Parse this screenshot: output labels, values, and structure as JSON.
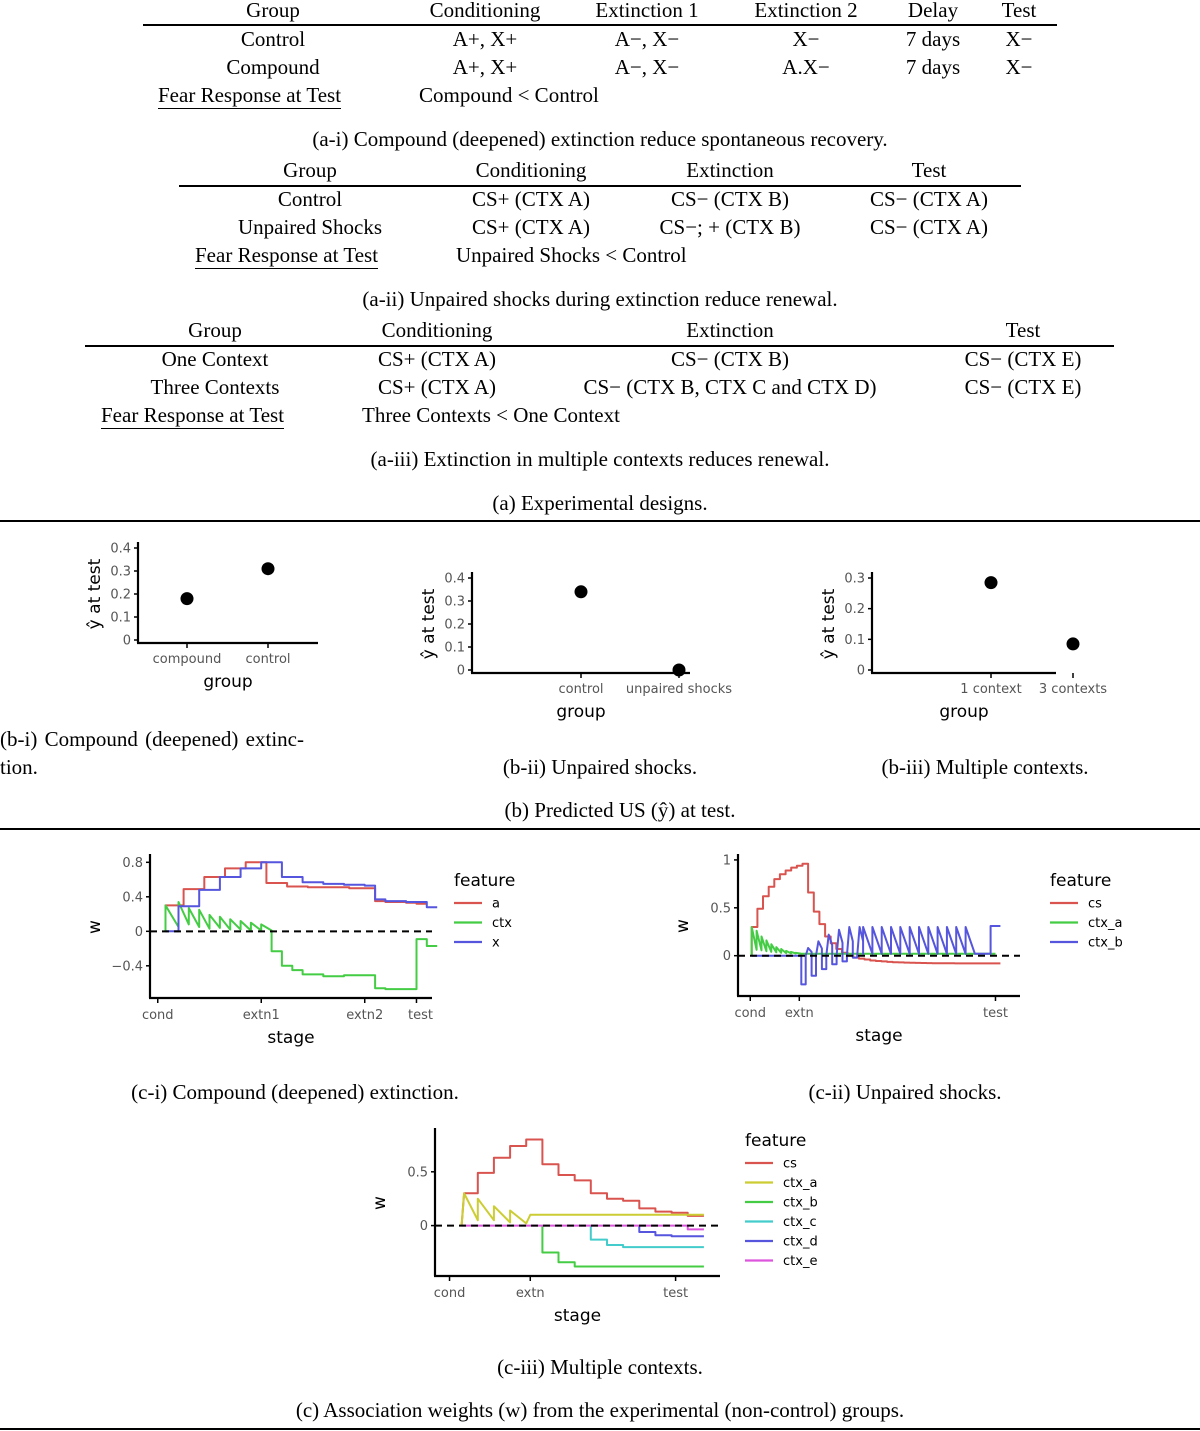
{
  "section_a": {
    "table1": {
      "headers": [
        "Group",
        "Conditioning",
        "Extinction 1",
        "Extinction 2",
        "Delay",
        "Test"
      ],
      "rows": [
        [
          "Control",
          "A+, X+",
          "A−, X−",
          "X−",
          "7 days",
          "X−"
        ],
        [
          "Compound",
          "A+, X+",
          "A−, X−",
          "A.X−",
          "7 days",
          "X−"
        ]
      ],
      "result_label": "Fear Response at Test",
      "result_value": "Compound < Control",
      "caption": "(a-i) Compound (deepened) extinction reduce spontaneous recovery."
    },
    "table2": {
      "headers": [
        "Group",
        "Conditioning",
        "Extinction",
        "Test"
      ],
      "rows": [
        [
          "Control",
          "CS+ (CTX A)",
          "CS− (CTX B)",
          "CS− (CTX A)"
        ],
        [
          "Unpaired Shocks",
          "CS+ (CTX A)",
          "CS−; + (CTX B)",
          "CS− (CTX A)"
        ]
      ],
      "result_label": "Fear Response at Test",
      "result_value": "Unpaired Shocks < Control",
      "caption": "(a-ii) Unpaired shocks during extinction reduce renewal."
    },
    "table3": {
      "headers": [
        "Group",
        "Conditioning",
        "Extinction",
        "Test"
      ],
      "rows": [
        [
          "One Context",
          "CS+ (CTX A)",
          "CS− (CTX B)",
          "CS− (CTX E)"
        ],
        [
          "Three Contexts",
          "CS+ (CTX A)",
          "CS− (CTX B, CTX C and CTX D)",
          "CS− (CTX E)"
        ]
      ],
      "result_label": "Fear Response at Test",
      "result_value": "Three Contexts < One Context",
      "caption": "(a-iii) Extinction in multiple contexts reduces renewal."
    },
    "caption": "(a) Experimental designs."
  },
  "section_b": {
    "caption_bi_line1": "(b-i)   Compound   (deepened)   extinc-",
    "caption_bi_line2": "tion.",
    "caption_bii": "(b-ii) Unpaired shocks.",
    "caption_biii": "(b-iii) Multiple contexts.",
    "caption": "(b) Predicted US (ŷ) at test."
  },
  "section_c": {
    "caption_ci": "(c-i) Compound (deepened) extinction.",
    "caption_cii": "(c-ii) Unpaired shocks.",
    "caption_ciii": "(c-iii) Multiple contexts.",
    "caption": "(c) Association weights (w) from the experimental (non-control) groups."
  },
  "chart_data": [
    {
      "id": "b-i",
      "type": "scatter",
      "xlabel": "group",
      "ylabel": "ŷ at test",
      "categories": [
        "compound",
        "control"
      ],
      "values": [
        0.18,
        0.31
      ],
      "ylim": [
        0,
        0.4
      ],
      "yticks": [
        0,
        0.1,
        0.2,
        0.3,
        0.4
      ],
      "ytick_labels": [
        "0",
        "0.1",
        "0.2",
        "0.3",
        "0.4"
      ]
    },
    {
      "id": "b-ii",
      "type": "scatter",
      "xlabel": "group",
      "ylabel": "ŷ at test",
      "categories": [
        "control",
        "unpaired shocks"
      ],
      "values": [
        0.34,
        0.0
      ],
      "ylim": [
        0,
        0.4
      ],
      "yticks": [
        0,
        0.1,
        0.2,
        0.3,
        0.4
      ],
      "ytick_labels": [
        "0",
        "0.1",
        "0.2",
        "0.3",
        "0.4"
      ]
    },
    {
      "id": "b-iii",
      "type": "scatter",
      "xlabel": "group",
      "ylabel": "ŷ at test",
      "categories": [
        "1 context",
        "3 contexts"
      ],
      "values": [
        0.285,
        0.085
      ],
      "ylim": [
        0,
        0.3
      ],
      "yticks": [
        0,
        0.1,
        0.2,
        0.3
      ],
      "ytick_labels": [
        "0",
        "0.1",
        "0.2",
        "0.3"
      ]
    },
    {
      "id": "c-i",
      "type": "line",
      "xlabel": "stage",
      "ylabel": "w",
      "legend_title": "feature",
      "legend_position": "right",
      "xticks": [
        {
          "x": 0,
          "label": "cond"
        },
        {
          "x": 20,
          "label": "extn1"
        },
        {
          "x": 40,
          "label": "extn2"
        },
        {
          "x": 50,
          "label": "test"
        }
      ],
      "xlim": [
        -1.5,
        53
      ],
      "ylim": [
        -0.75,
        0.85
      ],
      "yticks": [
        -0.4,
        0,
        0.4,
        0.8
      ],
      "ytick_labels": [
        "−0.4",
        "0",
        "0.4",
        "0.8"
      ],
      "series": [
        {
          "name": "a",
          "color": "#d9534f",
          "kind": "step",
          "points": [
            [
              1.5,
              0
            ],
            [
              1.5,
              0.3
            ],
            [
              5,
              0.3
            ],
            [
              5,
              0.49
            ],
            [
              9,
              0.49
            ],
            [
              9,
              0.63
            ],
            [
              13,
              0.63
            ],
            [
              13,
              0.73
            ],
            [
              17,
              0.73
            ],
            [
              17,
              0.8
            ],
            [
              21,
              0.8
            ],
            [
              21,
              0.56
            ],
            [
              25,
              0.56
            ],
            [
              25,
              0.52
            ],
            [
              29,
              0.52
            ],
            [
              29,
              0.51
            ],
            [
              37,
              0.51
            ],
            [
              37,
              0.5
            ],
            [
              42,
              0.5
            ],
            [
              42,
              0.35
            ],
            [
              44,
              0.35
            ],
            [
              44,
              0.34
            ],
            [
              48,
              0.34
            ],
            [
              48,
              0.33
            ],
            [
              50,
              0.33
            ],
            [
              50,
              0.32
            ],
            [
              52,
              0.32
            ]
          ]
        },
        {
          "name": "ctx",
          "color": "#44cc44",
          "kind": "line",
          "points": [
            [
              1.5,
              0
            ],
            [
              1.5,
              0.3
            ],
            [
              4,
              0.05
            ],
            [
              4,
              0.34
            ],
            [
              6,
              0.08
            ],
            [
              6,
              0.27
            ],
            [
              8,
              0.05
            ],
            [
              8,
              0.25
            ],
            [
              10,
              0.03
            ],
            [
              10,
              0.19
            ],
            [
              12,
              0.04
            ],
            [
              12,
              0.17
            ],
            [
              14,
              0.02
            ],
            [
              14,
              0.14
            ],
            [
              16,
              0.02
            ],
            [
              16,
              0.12
            ],
            [
              18,
              0.01
            ],
            [
              18,
              0.1
            ],
            [
              20,
              0.01
            ],
            [
              20,
              0.08
            ],
            [
              22,
              0.01
            ],
            [
              22,
              -0.23
            ],
            [
              24,
              -0.23
            ],
            [
              24,
              -0.4
            ],
            [
              26,
              -0.4
            ],
            [
              26,
              -0.45
            ],
            [
              28,
              -0.45
            ],
            [
              28,
              -0.5
            ],
            [
              32,
              -0.5
            ],
            [
              32,
              -0.52
            ],
            [
              36,
              -0.52
            ],
            [
              36,
              -0.51
            ],
            [
              42,
              -0.51
            ],
            [
              42,
              -0.66
            ],
            [
              44,
              -0.66
            ],
            [
              44,
              -0.67
            ],
            [
              50,
              -0.67
            ],
            [
              50,
              -0.09
            ],
            [
              52,
              -0.09
            ],
            [
              52,
              -0.17
            ],
            [
              54,
              -0.17
            ]
          ]
        },
        {
          "name": "x",
          "color": "#5555dd",
          "kind": "step",
          "points": [
            [
              1.5,
              0
            ],
            [
              4,
              0
            ],
            [
              4,
              0.29
            ],
            [
              8,
              0.29
            ],
            [
              8,
              0.48
            ],
            [
              12,
              0.48
            ],
            [
              12,
              0.63
            ],
            [
              16,
              0.63
            ],
            [
              16,
              0.73
            ],
            [
              20,
              0.73
            ],
            [
              20,
              0.8
            ],
            [
              24,
              0.8
            ],
            [
              24,
              0.63
            ],
            [
              28,
              0.63
            ],
            [
              28,
              0.57
            ],
            [
              32,
              0.57
            ],
            [
              32,
              0.55
            ],
            [
              36,
              0.55
            ],
            [
              36,
              0.54
            ],
            [
              40,
              0.54
            ],
            [
              40,
              0.53
            ],
            [
              42,
              0.53
            ],
            [
              42,
              0.37
            ],
            [
              44,
              0.37
            ],
            [
              44,
              0.35
            ],
            [
              48,
              0.35
            ],
            [
              48,
              0.34
            ],
            [
              52,
              0.34
            ],
            [
              52,
              0.28
            ],
            [
              54,
              0.28
            ]
          ]
        }
      ]
    },
    {
      "id": "c-ii",
      "type": "line",
      "xlabel": "stage",
      "ylabel": "w",
      "legend_title": "feature",
      "legend_position": "right",
      "xticks": [
        {
          "x": 0,
          "label": "cond"
        },
        {
          "x": 10,
          "label": "extn"
        },
        {
          "x": 50,
          "label": "test"
        }
      ],
      "xlim": [
        -2.5,
        55
      ],
      "ylim": [
        -0.4,
        1.02
      ],
      "yticks": [
        0,
        0.5,
        1
      ],
      "ytick_labels": [
        "0",
        "0.5",
        "1"
      ],
      "series": [
        {
          "name": "cs",
          "color": "#d9534f",
          "kind": "step",
          "values": [
            0.3,
            0.49,
            0.62,
            0.72,
            0.8,
            0.85,
            0.89,
            0.92,
            0.94,
            0.96,
            0.66,
            0.46,
            0.33,
            0.2,
            0.13,
            0.07,
            0.03,
            0.0,
            -0.02,
            -0.03,
            -0.04,
            -0.05,
            -0.055,
            -0.06,
            -0.065,
            -0.068,
            -0.07,
            -0.072,
            -0.074,
            -0.075,
            -0.076,
            -0.077,
            -0.078,
            -0.078,
            -0.079,
            -0.079,
            -0.08,
            -0.08,
            -0.08,
            -0.08,
            -0.08,
            -0.08
          ]
        },
        {
          "name": "ctx_a",
          "color": "#44cc44",
          "kind": "saw",
          "peaks": [
            0.3,
            0.26,
            0.2,
            0.16,
            0.12,
            0.09,
            0.07,
            0.05,
            0.04,
            0.03
          ],
          "floor": 0.02
        },
        {
          "name": "ctx_b",
          "color": "#5555dd",
          "kind": "saw",
          "dips": [
            -0.3,
            -0.21,
            -0.14,
            -0.09,
            -0.06,
            -0.02
          ],
          "peaks": [
            0.0,
            0.08,
            0.15,
            0.22,
            0.27,
            0.3,
            0.3,
            0.3,
            0.3,
            0.3,
            0.3,
            0.3,
            0.3,
            0.3,
            0.3,
            0.3,
            0.3,
            0.3,
            0.3
          ],
          "final": 0.31
        }
      ]
    },
    {
      "id": "c-iii",
      "type": "line",
      "xlabel": "stage",
      "ylabel": "w",
      "legend_title": "feature",
      "legend_position": "right",
      "xticks": [
        {
          "x": 0,
          "label": "cond"
        },
        {
          "x": 10,
          "label": "extn"
        },
        {
          "x": 28,
          "label": "test"
        }
      ],
      "xlim": [
        -1.8,
        33.5
      ],
      "ylim": [
        -0.45,
        0.87
      ],
      "yticks": [
        0,
        0.5
      ],
      "ytick_labels": [
        "0",
        "0.5"
      ],
      "series": [
        {
          "name": "cs",
          "color": "#d9534f",
          "kind": "step",
          "points": [
            [
              1.5,
              0
            ],
            [
              1.8,
              0.3
            ],
            [
              3.5,
              0.3
            ],
            [
              3.5,
              0.49
            ],
            [
              5.5,
              0.49
            ],
            [
              5.5,
              0.63
            ],
            [
              7.5,
              0.63
            ],
            [
              7.5,
              0.74
            ],
            [
              9.5,
              0.74
            ],
            [
              9.5,
              0.8
            ],
            [
              11.5,
              0.8
            ],
            [
              11.5,
              0.57
            ],
            [
              13.5,
              0.57
            ],
            [
              13.5,
              0.47
            ],
            [
              15.5,
              0.47
            ],
            [
              15.5,
              0.42
            ],
            [
              17.5,
              0.42
            ],
            [
              17.5,
              0.3
            ],
            [
              19.5,
              0.3
            ],
            [
              19.5,
              0.25
            ],
            [
              21.5,
              0.25
            ],
            [
              21.5,
              0.23
            ],
            [
              23.5,
              0.23
            ],
            [
              23.5,
              0.16
            ],
            [
              25.5,
              0.16
            ],
            [
              25.5,
              0.13
            ],
            [
              27.5,
              0.13
            ],
            [
              27.5,
              0.12
            ],
            [
              29.5,
              0.12
            ],
            [
              29.5,
              0.09
            ],
            [
              31.5,
              0.09
            ]
          ]
        },
        {
          "name": "ctx_a",
          "color": "#cccc33",
          "kind": "line",
          "points": [
            [
              1.5,
              0
            ],
            [
              1.8,
              0.3
            ],
            [
              3.5,
              0.05
            ],
            [
              3.5,
              0.25
            ],
            [
              5.5,
              0.05
            ],
            [
              5.5,
              0.18
            ],
            [
              7.5,
              0.03
            ],
            [
              7.5,
              0.14
            ],
            [
              9.5,
              0.02
            ],
            [
              10,
              0.1
            ],
            [
              31.5,
              0.1
            ]
          ]
        },
        {
          "name": "ctx_b",
          "color": "#44cc44",
          "kind": "step",
          "points": [
            [
              11.5,
              0
            ],
            [
              11.5,
              -0.25
            ],
            [
              13.5,
              -0.25
            ],
            [
              13.5,
              -0.34
            ],
            [
              15.5,
              -0.34
            ],
            [
              15.5,
              -0.38
            ],
            [
              31.5,
              -0.38
            ]
          ]
        },
        {
          "name": "ctx_c",
          "color": "#44cccc",
          "kind": "step",
          "points": [
            [
              17.5,
              0
            ],
            [
              17.5,
              -0.13
            ],
            [
              19.5,
              -0.13
            ],
            [
              19.5,
              -0.18
            ],
            [
              21.5,
              -0.18
            ],
            [
              21.5,
              -0.2
            ],
            [
              31.5,
              -0.2
            ]
          ]
        },
        {
          "name": "ctx_d",
          "color": "#5555dd",
          "kind": "step",
          "points": [
            [
              23.5,
              0
            ],
            [
              23.5,
              -0.06
            ],
            [
              25.5,
              -0.06
            ],
            [
              25.5,
              -0.09
            ],
            [
              27.5,
              -0.09
            ],
            [
              27.5,
              -0.1
            ],
            [
              31.5,
              -0.1
            ]
          ]
        },
        {
          "name": "ctx_e",
          "color": "#dd55dd",
          "kind": "step",
          "points": [
            [
              1.5,
              0
            ],
            [
              29.5,
              0
            ],
            [
              29.5,
              -0.035
            ],
            [
              31.5,
              -0.035
            ]
          ]
        }
      ]
    }
  ]
}
